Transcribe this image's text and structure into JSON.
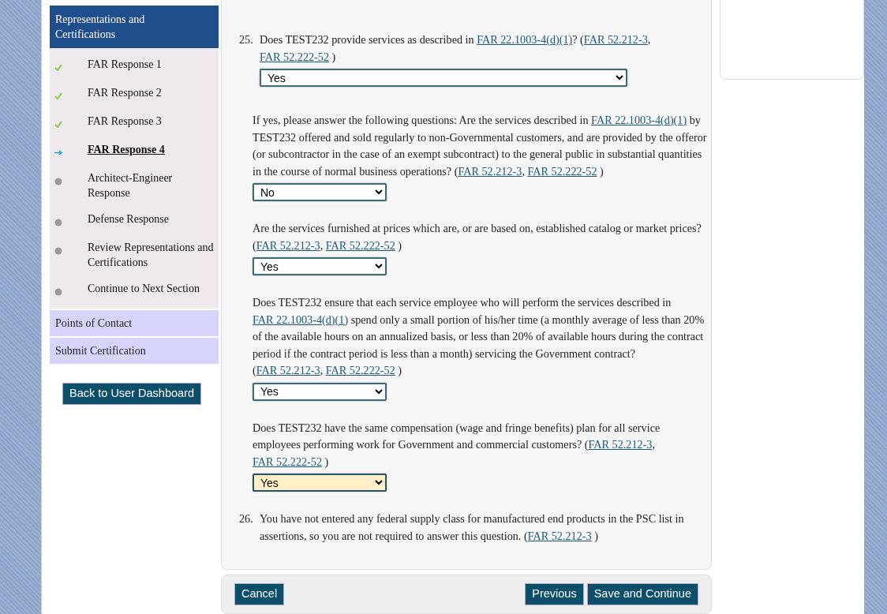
{
  "sidebar": {
    "header": "Representations and Certifications",
    "steps": [
      {
        "label": "FAR Response 1",
        "kind": "done",
        "selected": false
      },
      {
        "label": "FAR Response 2",
        "kind": "done",
        "selected": false
      },
      {
        "label": "FAR Response 3",
        "kind": "done",
        "selected": false
      },
      {
        "label": "FAR Response 4",
        "kind": "current",
        "selected": true
      },
      {
        "label": "Architect-Engineer Response",
        "kind": "pending",
        "selected": false
      },
      {
        "label": "Defense Response",
        "kind": "pending",
        "selected": false
      },
      {
        "label": "Review Representations and Certifications",
        "kind": "pending",
        "selected": false
      },
      {
        "label": "Continue to Next Section",
        "kind": "pending",
        "selected": false
      }
    ],
    "sections": [
      "Points of Contact",
      "Submit Certification"
    ],
    "back_button": "Back to User Dashboard"
  },
  "questions": [
    {
      "number": "25.",
      "segments": [
        {
          "kind": "text",
          "text": "Does TEST232 provide services as described in "
        },
        {
          "kind": "link",
          "text": "FAR 22.1003-4(d)(1)"
        },
        {
          "kind": "text",
          "text": "? ("
        },
        {
          "kind": "link",
          "text": "FAR 52.212-3"
        },
        {
          "kind": "text",
          "text": ", "
        },
        {
          "kind": "link",
          "text": "FAR 52.222-52"
        },
        {
          "kind": "text",
          "text": " )"
        }
      ],
      "answer": {
        "value": "Yes",
        "focused": false
      },
      "followups": [
        {
          "segments": [
            {
              "kind": "text",
              "text": "If yes, please answer the following questions: Are the services described in "
            },
            {
              "kind": "link",
              "text": "FAR 22.1003-4(d)(1)"
            },
            {
              "kind": "text",
              "text": " by TEST232 offered and sold regularly to non-Governmental customers, and are provided by the offeror (or subcontractor in the case of an exempt subcontract) to the general public in substantial quantities in the course of normal business operations? ("
            },
            {
              "kind": "link",
              "text": "FAR 52.212-3"
            },
            {
              "kind": "text",
              "text": ", "
            },
            {
              "kind": "link",
              "text": "FAR 52.222-52"
            },
            {
              "kind": "text",
              "text": " )"
            }
          ],
          "answer": {
            "value": "No",
            "focused": false
          }
        },
        {
          "segments": [
            {
              "kind": "text",
              "text": "Are the services furnished at prices which are, or are based on, established catalog or market prices? ("
            },
            {
              "kind": "link",
              "text": "FAR 52.212-3"
            },
            {
              "kind": "text",
              "text": ", "
            },
            {
              "kind": "link",
              "text": "FAR 52.222-52"
            },
            {
              "kind": "text",
              "text": " )"
            }
          ],
          "answer": {
            "value": "Yes",
            "focused": false
          }
        },
        {
          "segments": [
            {
              "kind": "text",
              "text": "Does TEST232 ensure that each service employee who will perform the services described in "
            },
            {
              "kind": "link",
              "text": "FAR 22.1003-4(d)(1)"
            },
            {
              "kind": "text",
              "text": " spend only a small portion of his/her time (a monthly average of less than 20% of the available hours on an annualized basis, or less than 20% of available hours during the contract period if the contract period is less than a month) servicing the Government contract? ("
            },
            {
              "kind": "link",
              "text": "FAR 52.212-3"
            },
            {
              "kind": "text",
              "text": ", "
            },
            {
              "kind": "link",
              "text": "FAR 52.222-52"
            },
            {
              "kind": "text",
              "text": " )"
            }
          ],
          "answer": {
            "value": "Yes",
            "focused": false
          }
        },
        {
          "segments": [
            {
              "kind": "text",
              "text": "Does TEST232 have the same compensation (wage and fringe benefits) plan for all service employees performing work for Government and commercial customers? ("
            },
            {
              "kind": "link",
              "text": "FAR 52.212-3"
            },
            {
              "kind": "text",
              "text": ", "
            },
            {
              "kind": "link",
              "text": "FAR 52.222-52"
            },
            {
              "kind": "text",
              "text": " )"
            }
          ],
          "answer": {
            "value": "Yes",
            "focused": true
          }
        }
      ]
    },
    {
      "number": "26.",
      "segments": [
        {
          "kind": "text",
          "text": "You have not entered any federal supply class for manufactured end products in the PSC list in assertions, so you are not required to answer this question. ("
        },
        {
          "kind": "link",
          "text": "FAR 52.212-3"
        },
        {
          "kind": "text",
          "text": " )"
        }
      ]
    }
  ],
  "footer": {
    "left": [
      "Cancel"
    ],
    "right": [
      "Previous",
      "Save and Continue"
    ]
  }
}
